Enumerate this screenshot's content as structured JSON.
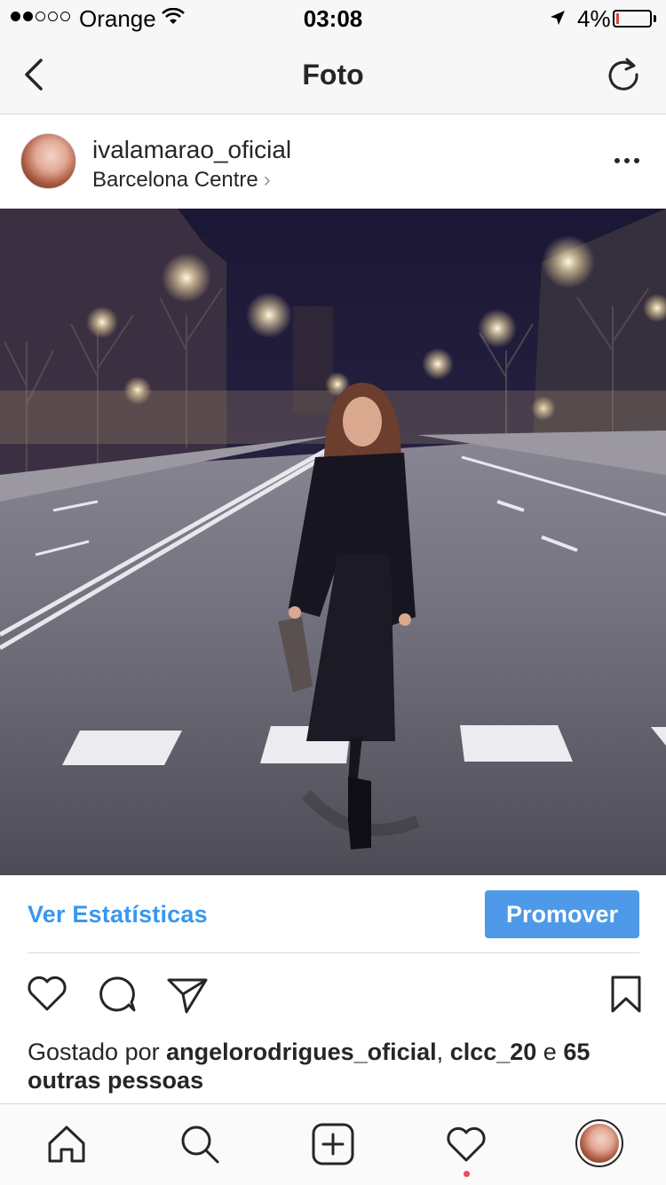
{
  "status_bar": {
    "carrier": "Orange",
    "time": "03:08",
    "battery_percent": "4%",
    "battery_level": 0.04,
    "signal_bars_filled": 2,
    "signal_bars_total": 5
  },
  "nav": {
    "title": "Foto",
    "back_icon": "chevron-left-icon",
    "refresh_icon": "refresh-icon"
  },
  "post": {
    "username": "ivalamarao_oficial",
    "location": "Barcelona Centre",
    "location_chevron": "›",
    "more_icon": "more-horizontal-icon",
    "photo_description_icon": "photo"
  },
  "stats": {
    "view_stats_label": "Ver Estatísticas",
    "promote_label": "Promover"
  },
  "actions": {
    "like_icon": "heart-icon",
    "comment_icon": "comment-icon",
    "share_icon": "send-icon",
    "save_icon": "bookmark-icon"
  },
  "likes": {
    "prefix": "Gostado por ",
    "user1": "angelorodrigues_oficial",
    "sep": ", ",
    "user2": "clcc_20",
    "conj": " e ",
    "others": "65 outras pessoas"
  },
  "tabbar": {
    "items": [
      "home-icon",
      "search-icon",
      "add-icon",
      "activity-heart-icon",
      "profile-avatar"
    ]
  },
  "colors": {
    "accent": "#3897f0",
    "promote_bg": "#4e9ae8",
    "notification_dot": "#ed4956",
    "battery_low": "#e0423a"
  }
}
